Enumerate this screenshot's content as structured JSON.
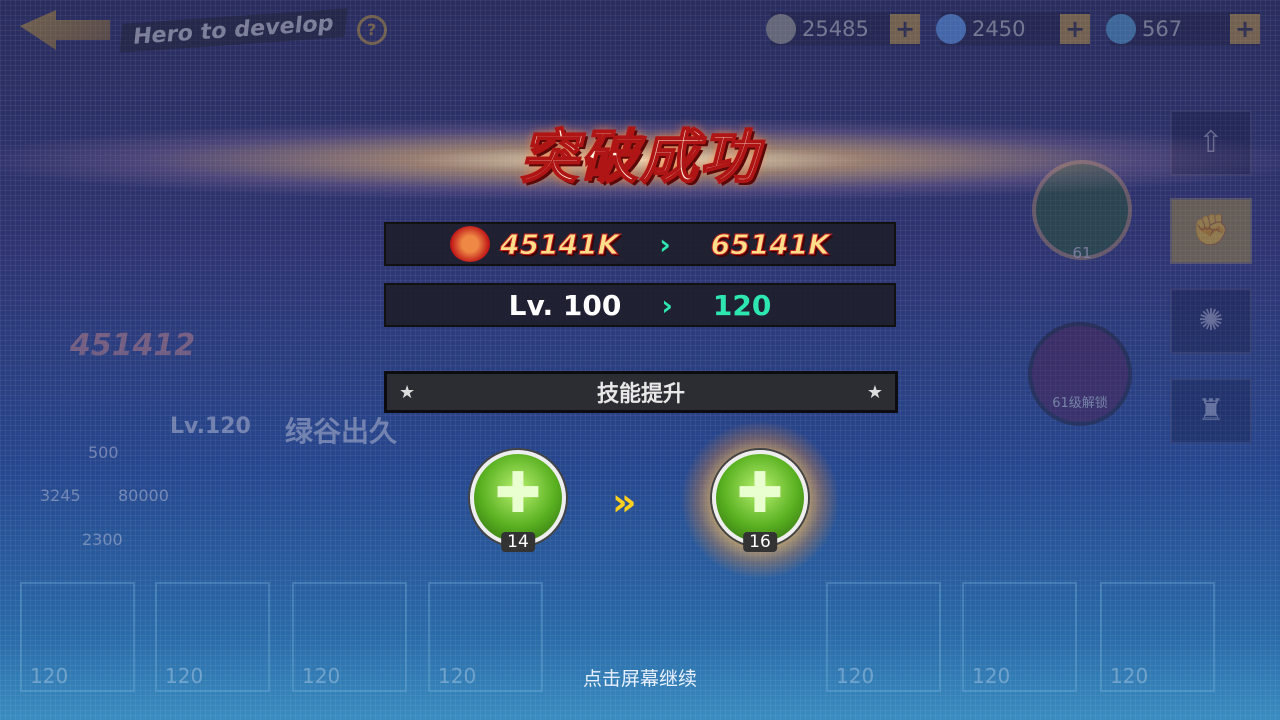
{
  "header": {
    "back_label": "Hero to develop",
    "help": "?",
    "resources": [
      {
        "icon": "coin-icon",
        "value": "25485"
      },
      {
        "icon": "diamond-icon",
        "value": "2450"
      },
      {
        "icon": "stamina-icon",
        "value": "567"
      }
    ],
    "plus": "+"
  },
  "banner": {
    "title": "突破成功"
  },
  "power": {
    "icon": "fist-icon",
    "from": "45141K",
    "arrow": "›",
    "to": "65141K"
  },
  "level": {
    "prefix": "Lv.",
    "from": "100",
    "arrow": "›",
    "to": "120"
  },
  "skill_section": {
    "title": "技能提升",
    "star": "★"
  },
  "skills": {
    "old_level": "14",
    "new_level": "16",
    "arrow": "»",
    "icon": "heal-cross-icon"
  },
  "background": {
    "hero_power": "451412",
    "hero_level": "Lv.120",
    "hero_name": "绿谷出久",
    "stats": [
      "500",
      "3245",
      "80000",
      "2300"
    ],
    "lock_text": "61级解锁",
    "skill_node_level": "61",
    "card_level": "120"
  },
  "colors": {
    "accent_green": "#2ee6b0",
    "power_gold": "#ffdf8a",
    "skill_arrow": "#ffd020"
  },
  "footer": {
    "hint": "点击屏幕继续"
  }
}
